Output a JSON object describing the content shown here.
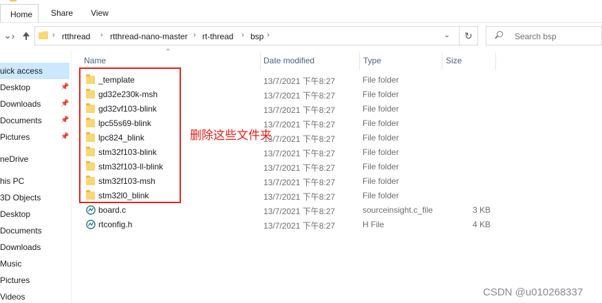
{
  "ribbon": {
    "tabs": [
      "Home",
      "Share",
      "View"
    ]
  },
  "address": {
    "crumbs": [
      "rtthread",
      "rtthread-nano-master",
      "rt-thread",
      "bsp"
    ],
    "search_placeholder": "Search bsp"
  },
  "nav_pane": {
    "items": [
      {
        "label": "uick access",
        "pinned": false,
        "selected": true
      },
      {
        "label": "Desktop",
        "pinned": true
      },
      {
        "label": "Downloads",
        "pinned": true
      },
      {
        "label": "Documents",
        "pinned": true
      },
      {
        "label": "Pictures",
        "pinned": true
      },
      {
        "label": "neDrive",
        "pinned": false
      },
      {
        "label": "his PC",
        "pinned": false
      },
      {
        "label": "3D Objects",
        "pinned": false
      },
      {
        "label": "Desktop",
        "pinned": false
      },
      {
        "label": "Documents",
        "pinned": false
      },
      {
        "label": "Downloads",
        "pinned": false
      },
      {
        "label": "Music",
        "pinned": false
      },
      {
        "label": "Pictures",
        "pinned": false
      },
      {
        "label": "Videos",
        "pinned": false
      }
    ]
  },
  "columns": {
    "name": "Name",
    "date": "Date modified",
    "type": "Type",
    "size": "Size"
  },
  "files": [
    {
      "name": "_template",
      "date": "13/7/2021 下午8:27",
      "type": "File folder",
      "size": "",
      "icon": "folder"
    },
    {
      "name": "gd32e230k-msh",
      "date": "13/7/2021 下午8:27",
      "type": "File folder",
      "size": "",
      "icon": "folder"
    },
    {
      "name": "gd32vf103-blink",
      "date": "13/7/2021 下午8:27",
      "type": "File folder",
      "size": "",
      "icon": "folder"
    },
    {
      "name": "lpc55s69-blink",
      "date": "13/7/2021 下午8:27",
      "type": "File folder",
      "size": "",
      "icon": "folder"
    },
    {
      "name": "lpc824_blink",
      "date": "13/7/2021 下午8:27",
      "type": "File folder",
      "size": "",
      "icon": "folder"
    },
    {
      "name": "stm32f103-blink",
      "date": "13/7/2021 下午8:27",
      "type": "File folder",
      "size": "",
      "icon": "folder"
    },
    {
      "name": "stm32f103-ll-blink",
      "date": "13/7/2021 下午8:27",
      "type": "File folder",
      "size": "",
      "icon": "folder"
    },
    {
      "name": "stm32f103-msh",
      "date": "13/7/2021 下午8:27",
      "type": "File folder",
      "size": "",
      "icon": "folder"
    },
    {
      "name": "stm32l0_blink",
      "date": "13/7/2021 下午8:27",
      "type": "File folder",
      "size": "",
      "icon": "folder"
    },
    {
      "name": "board.c",
      "date": "13/7/2021 下午8:27",
      "type": "sourceinsight.c_file",
      "size": "3 KB",
      "icon": "source-file"
    },
    {
      "name": "rtconfig.h",
      "date": "13/7/2021 下午8:27",
      "type": "H File",
      "size": "4 KB",
      "icon": "source-file"
    }
  ],
  "annotation": {
    "text": "删除这些文件夹",
    "color": "#e0211b"
  },
  "watermark": "CSDN @u010268337"
}
